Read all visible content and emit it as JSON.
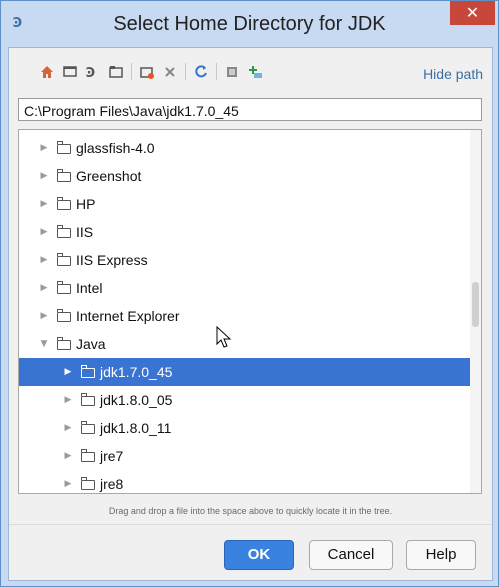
{
  "window": {
    "title": "Select Home Directory for JDK",
    "app_icon": "intellij-idea-icon",
    "close_label": "✕"
  },
  "toolbar": {
    "icons": [
      "home-icon",
      "desktop-icon",
      "project-icon",
      "module-icon",
      "new-folder-icon",
      "delete-icon",
      "refresh-icon",
      "show-hidden-icon",
      "add-folder-icon"
    ],
    "hide_path_label": "Hide path"
  },
  "path": {
    "value": "C:\\Program Files\\Java\\jdk1.7.0_45"
  },
  "tree": {
    "items": [
      {
        "label": "glassfish-4.0",
        "expanded": false,
        "level": 0
      },
      {
        "label": "Greenshot",
        "expanded": false,
        "level": 0
      },
      {
        "label": "HP",
        "expanded": false,
        "level": 0
      },
      {
        "label": "IIS",
        "expanded": false,
        "level": 0
      },
      {
        "label": "IIS Express",
        "expanded": false,
        "level": 0
      },
      {
        "label": "Intel",
        "expanded": false,
        "level": 0
      },
      {
        "label": "Internet Explorer",
        "expanded": false,
        "level": 0
      },
      {
        "label": "Java",
        "expanded": true,
        "level": 0
      },
      {
        "label": "jdk1.7.0_45",
        "expanded": false,
        "level": 1,
        "selected": true
      },
      {
        "label": "jdk1.8.0_05",
        "expanded": false,
        "level": 1
      },
      {
        "label": "jdk1.8.0_11",
        "expanded": false,
        "level": 1
      },
      {
        "label": "jre7",
        "expanded": false,
        "level": 1
      },
      {
        "label": "jre8",
        "expanded": false,
        "level": 1
      }
    ],
    "arrow_collapsed": "▶",
    "arrow_expanded": "▼"
  },
  "hint": "Drag and drop a file into the space above to quickly locate it in the tree.",
  "buttons": {
    "ok": "OK",
    "cancel": "Cancel",
    "help": "Help"
  },
  "colors": {
    "selection": "#3a74d2",
    "ok_button": "#3a82e0",
    "link": "#3a6ea5",
    "close": "#c7473b"
  }
}
